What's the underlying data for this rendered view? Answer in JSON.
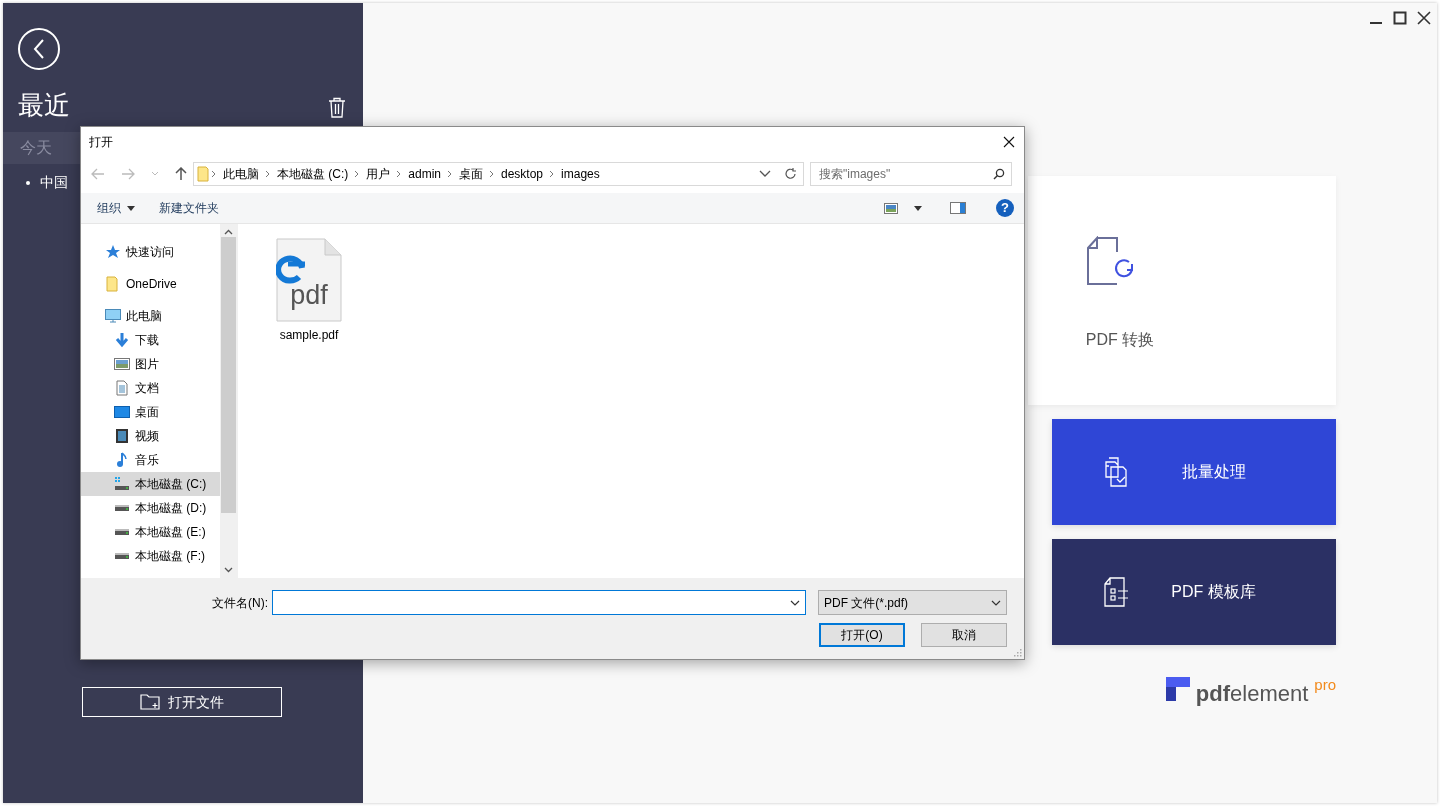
{
  "sidebar": {
    "title": "最近",
    "groups": [
      {
        "label": "今天",
        "items": [
          {
            "name": "中国"
          }
        ]
      }
    ],
    "open_button": "打开文件"
  },
  "tools": [
    {
      "kind": "card",
      "label": "PDF 转换"
    },
    {
      "kind": "primary",
      "label": "批量处理"
    },
    {
      "kind": "dark",
      "label": "PDF 模板库"
    }
  ],
  "logo": {
    "wordmark": "**pdf**element",
    "badge": "pro"
  },
  "dialog": {
    "title": "打开",
    "breadcrumb": [
      "此电脑",
      "本地磁盘 (C:)",
      "用户",
      "admin",
      "桌面",
      "desktop",
      "images"
    ],
    "search": {
      "placeholder": "搜索\"images\""
    },
    "toolbar": [
      {
        "label": "组织",
        "dropdown": true
      },
      {
        "label": "新建文件夹",
        "dropdown": false
      }
    ],
    "nav": [
      {
        "kind": "star",
        "label": "快速访问",
        "selected": false
      },
      {
        "kind": "folder",
        "label": "OneDrive",
        "selected": false
      },
      {
        "kind": "pc",
        "label": "此电脑",
        "selected": false,
        "children": [
          {
            "kind": "download",
            "label": "下载",
            "selected": false
          },
          {
            "kind": "picture",
            "label": "图片",
            "selected": false
          },
          {
            "kind": "document",
            "label": "文档",
            "selected": false
          },
          {
            "kind": "desktop",
            "label": "桌面",
            "selected": false
          },
          {
            "kind": "video",
            "label": "视频",
            "selected": false
          },
          {
            "kind": "music",
            "label": "音乐",
            "selected": false
          },
          {
            "kind": "sysdrive",
            "label": "本地磁盘 (C:)",
            "selected": true
          },
          {
            "kind": "drive",
            "label": "本地磁盘 (D:)",
            "selected": false
          },
          {
            "kind": "drive",
            "label": "本地磁盘 (E:)",
            "selected": false
          },
          {
            "kind": "drive",
            "label": "本地磁盘 (F:)",
            "selected": false
          }
        ]
      }
    ],
    "help_glyph": "?",
    "files": [
      {
        "name": "sample.pdf",
        "icon_text": "pdf"
      }
    ],
    "filename_label": "文件名(N):",
    "filetype": "PDF 文件(*.pdf)",
    "buttons": [
      {
        "label": "打开(O)",
        "default": true
      },
      {
        "label": "取消",
        "default": false
      }
    ]
  }
}
